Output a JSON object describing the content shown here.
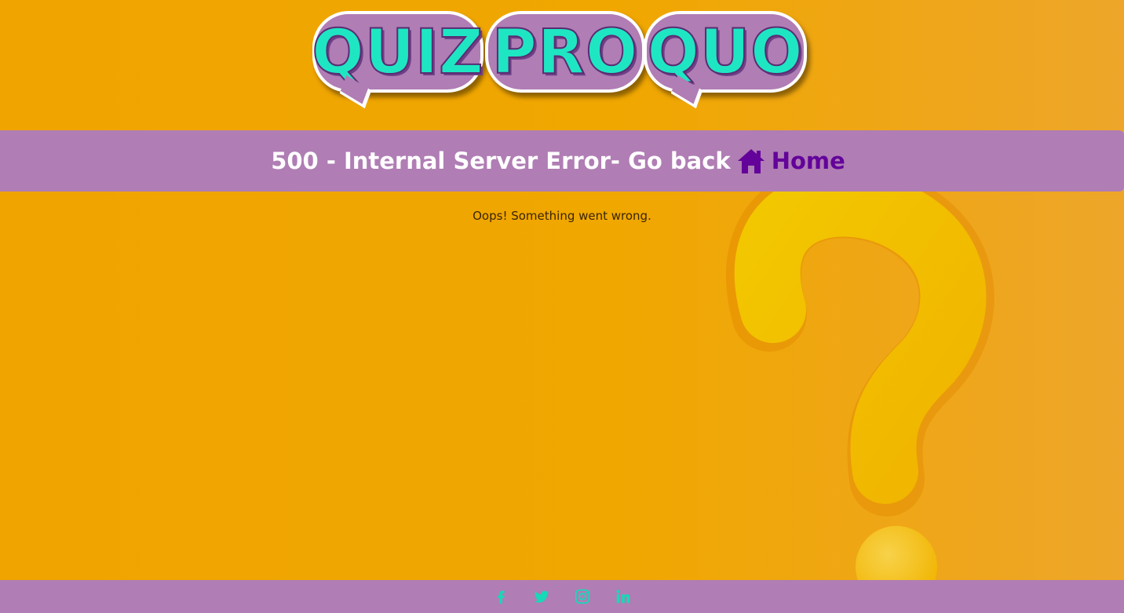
{
  "logo": {
    "words": [
      "QUIZ",
      "PRO",
      "QUO"
    ]
  },
  "header": {
    "prefix": "500 - Internal Server Error- Go back",
    "home_label": "Home",
    "home_icon": "home-icon"
  },
  "message": {
    "text": "Oops! Something went wrong."
  },
  "footer": {
    "icons": [
      "facebook-icon",
      "twitter-icon",
      "instagram-icon",
      "linkedin-icon"
    ]
  },
  "colors": {
    "background": "#f0a400",
    "band": "#b07db4",
    "home_link": "#63039a",
    "logo_text": "#1fe6c2",
    "social_icon": "#17d9b7",
    "header_text": "#ffffff"
  }
}
